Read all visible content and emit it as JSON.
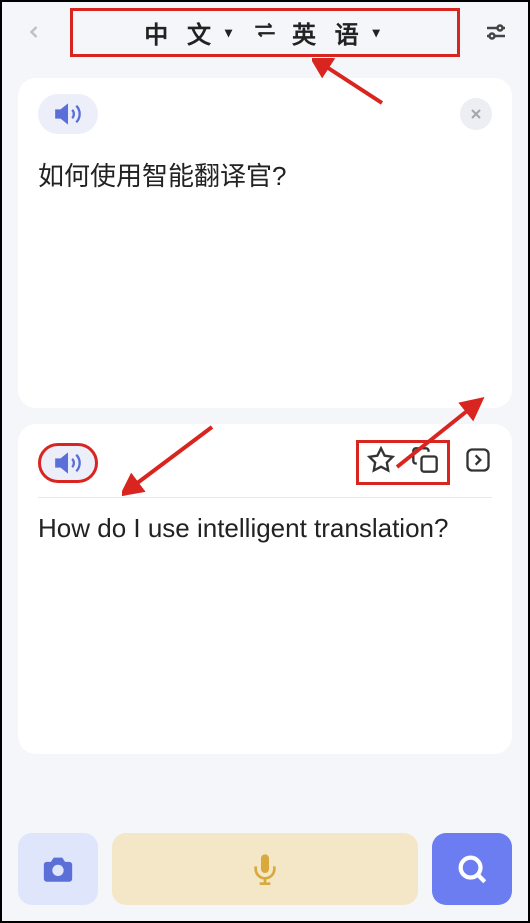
{
  "header": {
    "source_lang": "中 文",
    "target_lang": "英 语"
  },
  "source_card": {
    "text": "如何使用智能翻译官?"
  },
  "target_card": {
    "text": "How do I use intelligent translation?"
  }
}
